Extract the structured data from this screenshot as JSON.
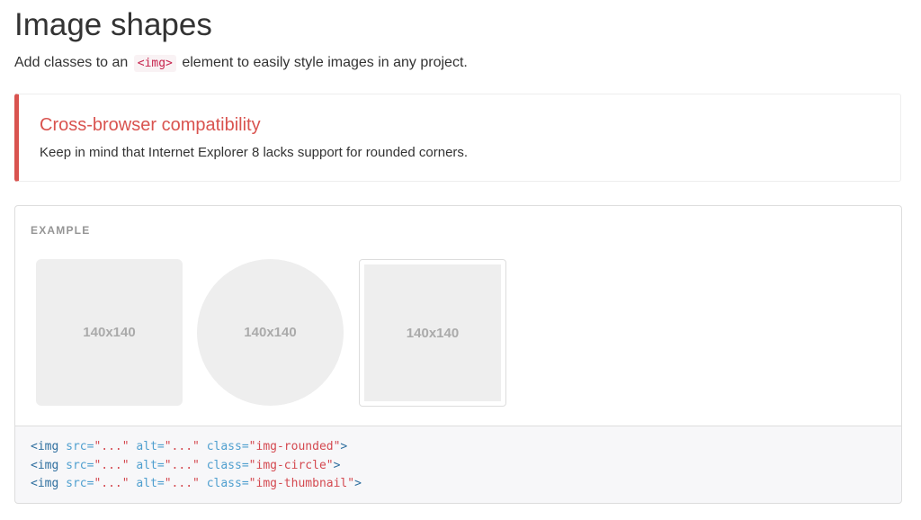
{
  "page": {
    "title": "Image shapes",
    "lead_before": "Add classes to an",
    "lead_code": "<img>",
    "lead_after": "element to easily style images in any project."
  },
  "callout": {
    "title": "Cross-browser compatibility",
    "text": "Keep in mind that Internet Explorer 8 lacks support for rounded corners.",
    "accent_color": "#d9534f"
  },
  "example": {
    "label": "EXAMPLE",
    "images": [
      {
        "label": "140x140",
        "shape": "rounded"
      },
      {
        "label": "140x140",
        "shape": "circle"
      },
      {
        "label": "140x140",
        "shape": "thumbnail"
      }
    ]
  },
  "code": {
    "lines": [
      {
        "tag": "<img",
        "src_attr": "src=",
        "src_val": "\"...\"",
        "alt_attr": "alt=",
        "alt_val": "\"...\"",
        "class_attr": "class=",
        "class_val": "\"img-rounded\"",
        "close": ">"
      },
      {
        "tag": "<img",
        "src_attr": "src=",
        "src_val": "\"...\"",
        "alt_attr": "alt=",
        "alt_val": "\"...\"",
        "class_attr": "class=",
        "class_val": "\"img-circle\"",
        "close": ">"
      },
      {
        "tag": "<img",
        "src_attr": "src=",
        "src_val": "\"...\"",
        "alt_attr": "alt=",
        "alt_val": "\"...\"",
        "class_attr": "class=",
        "class_val": "\"img-thumbnail\"",
        "close": ">"
      }
    ]
  }
}
